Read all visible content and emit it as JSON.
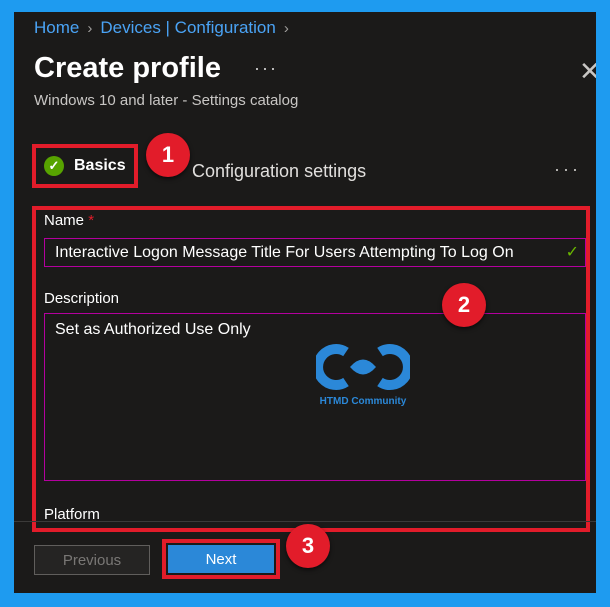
{
  "breadcrumb": {
    "home": "Home",
    "devices": "Devices | Configuration"
  },
  "header": {
    "title": "Create profile",
    "subtitle": "Windows 10 and later - Settings catalog",
    "more": "···"
  },
  "steps": {
    "basics": "Basics",
    "config": "Configuration settings",
    "more": "···"
  },
  "form": {
    "name_label": "Name",
    "required_marker": "*",
    "name_value": "Interactive Logon Message Title For Users Attempting To Log On",
    "description_label": "Description",
    "description_value": "Set as Authorized Use Only",
    "platform_label": "Platform"
  },
  "buttons": {
    "previous": "Previous",
    "next": "Next"
  },
  "annotations": {
    "one": "1",
    "two": "2",
    "three": "3"
  },
  "watermark": {
    "text": "HTMD Community"
  },
  "colors": {
    "accent": "#2b88d8",
    "highlight": "#e21c2a",
    "success": "#57a300",
    "input_border": "#b4009e"
  },
  "icons": {
    "close": "close-icon",
    "check": "check-circle-icon",
    "valid": "checkmark-icon"
  }
}
